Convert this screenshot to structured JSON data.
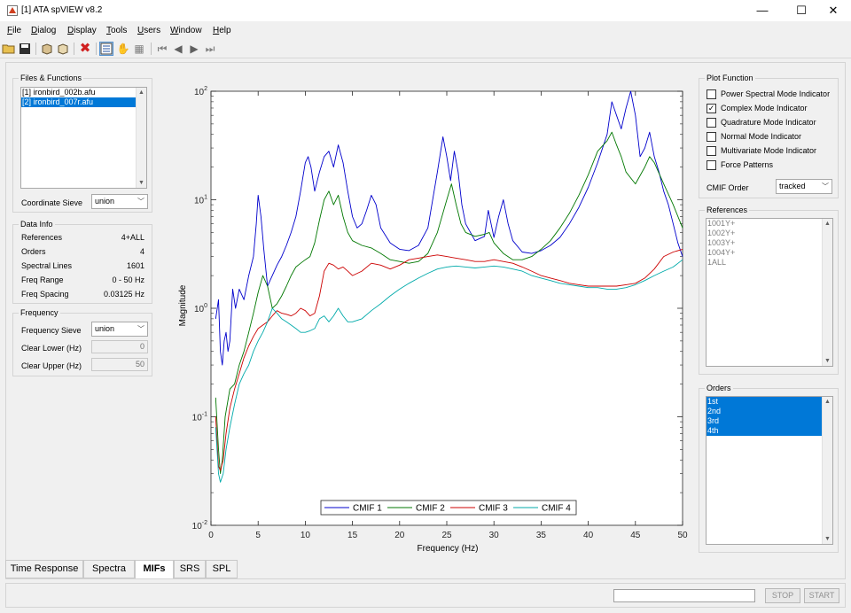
{
  "window": {
    "title": "[1] ATA spVIEW v8.2"
  },
  "menu": [
    {
      "label": "File",
      "u": "F",
      "rest": "ile"
    },
    {
      "label": "Dialog",
      "u": "D",
      "rest": "ialog"
    },
    {
      "label": "Display",
      "u": "D",
      "rest": "isplay"
    },
    {
      "label": "Tools",
      "u": "T",
      "rest": "ools"
    },
    {
      "label": "Users",
      "u": "U",
      "rest": "sers"
    },
    {
      "label": "Window",
      "u": "W",
      "rest": "indow"
    },
    {
      "label": "Help",
      "u": "H",
      "rest": "elp"
    }
  ],
  "files": {
    "title": "Files & Functions",
    "items": [
      "[1] ironbird_002b.afu",
      "[2] ironbird_007r.afu"
    ],
    "selected": 1,
    "coordinate_sieve_label": "Coordinate Sieve",
    "coordinate_sieve_value": "union"
  },
  "data_info": {
    "title": "Data Info",
    "rows": [
      {
        "label": "References",
        "value": "4+ALL"
      },
      {
        "label": "Orders",
        "value": "4"
      },
      {
        "label": "Spectral Lines",
        "value": "1601"
      },
      {
        "label": "Freq Range",
        "value": "0 - 50 Hz"
      },
      {
        "label": "Freq Spacing",
        "value": "0.03125 Hz"
      }
    ]
  },
  "frequency": {
    "title": "Frequency",
    "sieve_label": "Frequency Sieve",
    "sieve_value": "union",
    "clear_lower_label": "Clear Lower (Hz)",
    "clear_lower_value": "0",
    "clear_upper_label": "Clear Upper (Hz)",
    "clear_upper_value": "50"
  },
  "plot_function": {
    "title": "Plot Function",
    "options": [
      {
        "label": "Power Spectral Mode Indicator",
        "checked": false
      },
      {
        "label": "Complex Mode Indicator",
        "checked": true
      },
      {
        "label": "Quadrature Mode Indicator",
        "checked": false
      },
      {
        "label": "Normal Mode Indicator",
        "checked": false
      },
      {
        "label": "Multivariate Mode Indicator",
        "checked": false
      },
      {
        "label": "Force Patterns",
        "checked": false
      }
    ],
    "cmif_order_label": "CMIF Order",
    "cmif_order_value": "tracked"
  },
  "references": {
    "title": "References",
    "items": [
      "1001Y+",
      "1002Y+",
      "1003Y+",
      "1004Y+",
      "1ALL"
    ]
  },
  "orders": {
    "title": "Orders",
    "items": [
      "1st",
      "2nd",
      "3rd",
      "4th"
    ]
  },
  "tabs": [
    {
      "label": "Time Response",
      "active": false
    },
    {
      "label": "Spectra",
      "active": false
    },
    {
      "label": "MIFs",
      "active": true
    },
    {
      "label": "SRS",
      "active": false
    },
    {
      "label": "SPL",
      "active": false
    }
  ],
  "status": {
    "stop_label": "STOP",
    "start_label": "START"
  },
  "chart_data": {
    "type": "line",
    "xlabel": "Frequency (Hz)",
    "ylabel": "Magnitude",
    "xlim": [
      0,
      50
    ],
    "ylim": [
      0.01,
      100
    ],
    "yscale": "log",
    "xticks": [
      "0",
      "5",
      "10",
      "15",
      "20",
      "25",
      "30",
      "35",
      "40",
      "45",
      "50"
    ],
    "yticks": [
      {
        "base": "10",
        "exp": "-2"
      },
      {
        "base": "10",
        "exp": "-1"
      },
      {
        "base": "10",
        "exp": "0"
      },
      {
        "base": "10",
        "exp": "1"
      },
      {
        "base": "10",
        "exp": "2"
      }
    ],
    "legend_position": "bottom-center",
    "series": [
      {
        "name": "CMIF 1",
        "color": "#0000cc",
        "x": [
          0.5,
          0.8,
          1.0,
          1.2,
          1.4,
          1.6,
          1.8,
          2.0,
          2.3,
          2.6,
          3.0,
          3.5,
          4.0,
          4.5,
          4.8,
          5.0,
          5.3,
          5.6,
          6.0,
          6.5,
          7.0,
          7.5,
          8.0,
          8.5,
          9.0,
          9.5,
          10.0,
          10.3,
          10.6,
          11.0,
          11.5,
          12.0,
          12.5,
          13.0,
          13.5,
          14.0,
          14.5,
          15.0,
          15.5,
          16.0,
          16.5,
          17.0,
          17.5,
          18.0,
          19.0,
          20.0,
          21.0,
          22.0,
          23.0,
          24.0,
          24.6,
          25.0,
          25.4,
          25.8,
          26.2,
          26.6,
          27.0,
          28.0,
          29.0,
          29.4,
          30.0,
          30.5,
          31.0,
          31.5,
          32.0,
          33.0,
          34.0,
          35.0,
          36.0,
          37.0,
          38.0,
          39.0,
          40.0,
          41.0,
          42.0,
          42.5,
          43.0,
          43.5,
          44.0,
          44.5,
          45.0,
          45.5,
          46.0,
          46.5,
          47.0,
          47.5,
          48.0,
          48.5,
          49.0,
          49.5,
          50.0
        ],
        "y": [
          0.8,
          1.2,
          0.4,
          0.3,
          0.5,
          0.6,
          0.4,
          0.5,
          1.5,
          1.0,
          1.5,
          1.2,
          2.0,
          3.0,
          6.0,
          11.0,
          7.0,
          3.5,
          1.6,
          2.0,
          2.5,
          3.0,
          3.8,
          5.0,
          7.0,
          12.0,
          22.0,
          25.0,
          20.0,
          12.0,
          18.0,
          25.0,
          28.0,
          20.0,
          32.0,
          22.0,
          12.0,
          7.0,
          5.5,
          6.0,
          8.0,
          11.0,
          9.0,
          5.5,
          4.0,
          3.5,
          3.4,
          3.8,
          5.5,
          18.0,
          38.0,
          25.0,
          15.0,
          28.0,
          18.0,
          9.0,
          6.0,
          4.2,
          4.6,
          8.0,
          4.5,
          7.0,
          10.0,
          6.0,
          4.2,
          3.3,
          3.2,
          3.4,
          3.8,
          4.5,
          6.0,
          8.5,
          13.0,
          22.0,
          40.0,
          80.0,
          60.0,
          45.0,
          70.0,
          100.0,
          60.0,
          25.0,
          30.0,
          42.0,
          25.0,
          18.0,
          12.0,
          9.0,
          6.0,
          4.0,
          3.0
        ]
      },
      {
        "name": "CMIF 2",
        "color": "#007700",
        "x": [
          0.5,
          0.8,
          1.0,
          1.2,
          1.5,
          2.0,
          2.5,
          3.0,
          3.5,
          4.0,
          4.5,
          5.0,
          5.5,
          6.0,
          6.5,
          7.0,
          7.5,
          8.0,
          8.5,
          9.0,
          9.5,
          10.0,
          10.5,
          11.0,
          11.5,
          12.0,
          12.5,
          13.0,
          13.5,
          14.0,
          14.5,
          15.0,
          16.0,
          17.0,
          18.0,
          19.0,
          20.0,
          21.0,
          22.0,
          23.0,
          24.0,
          25.0,
          25.5,
          26.0,
          26.5,
          27.0,
          28.0,
          29.0,
          29.5,
          30.0,
          31.0,
          32.0,
          33.0,
          34.0,
          35.0,
          36.0,
          37.0,
          38.0,
          39.0,
          40.0,
          41.0,
          42.0,
          42.5,
          43.0,
          43.5,
          44.0,
          45.0,
          46.0,
          46.5,
          47.0,
          48.0,
          49.0,
          50.0
        ],
        "y": [
          0.15,
          0.05,
          0.03,
          0.04,
          0.1,
          0.18,
          0.2,
          0.3,
          0.4,
          0.6,
          0.9,
          1.4,
          2.0,
          1.6,
          1.0,
          1.1,
          1.3,
          1.6,
          2.0,
          2.4,
          2.6,
          2.8,
          3.0,
          4.0,
          6.5,
          10.0,
          12.0,
          9.0,
          11.0,
          7.0,
          5.0,
          4.2,
          3.8,
          3.6,
          3.2,
          2.8,
          2.7,
          2.6,
          2.7,
          3.2,
          5.0,
          10.0,
          14.0,
          9.0,
          6.0,
          5.0,
          4.6,
          4.8,
          5.0,
          4.0,
          3.2,
          2.8,
          2.8,
          3.0,
          3.5,
          4.2,
          5.5,
          7.5,
          11.0,
          17.0,
          28.0,
          35.0,
          42.0,
          32.0,
          25.0,
          18.0,
          14.0,
          20.0,
          25.0,
          22.0,
          14.0,
          9.0,
          5.5
        ]
      },
      {
        "name": "CMIF 3",
        "color": "#cc0000",
        "x": [
          0.5,
          0.8,
          1.0,
          1.3,
          1.6,
          2.0,
          2.5,
          3.0,
          3.5,
          4.0,
          4.5,
          5.0,
          5.5,
          6.0,
          6.5,
          7.0,
          7.5,
          8.0,
          8.5,
          9.0,
          9.5,
          10.0,
          10.5,
          11.0,
          11.5,
          12.0,
          12.5,
          13.0,
          13.5,
          14.0,
          14.5,
          15.0,
          16.0,
          17.0,
          18.0,
          19.0,
          20.0,
          21.0,
          22.0,
          23.0,
          24.0,
          25.0,
          26.0,
          27.0,
          28.0,
          29.0,
          30.0,
          31.0,
          32.0,
          33.0,
          34.0,
          35.0,
          36.0,
          37.0,
          38.0,
          39.0,
          40.0,
          41.0,
          42.0,
          43.0,
          44.0,
          45.0,
          46.0,
          47.0,
          48.0,
          49.0,
          50.0
        ],
        "y": [
          0.1,
          0.035,
          0.032,
          0.04,
          0.07,
          0.12,
          0.18,
          0.25,
          0.35,
          0.45,
          0.55,
          0.65,
          0.7,
          0.75,
          0.85,
          0.95,
          0.9,
          0.88,
          0.85,
          0.9,
          1.0,
          0.95,
          0.85,
          0.9,
          1.3,
          2.2,
          2.6,
          2.5,
          2.3,
          2.4,
          2.2,
          2.0,
          2.2,
          2.6,
          2.5,
          2.3,
          2.5,
          2.8,
          2.9,
          3.0,
          3.1,
          3.0,
          2.9,
          2.8,
          2.7,
          2.7,
          2.8,
          2.7,
          2.6,
          2.4,
          2.2,
          2.0,
          1.9,
          1.8,
          1.7,
          1.65,
          1.6,
          1.6,
          1.6,
          1.6,
          1.65,
          1.7,
          1.9,
          2.3,
          3.0,
          3.3,
          3.5
        ]
      },
      {
        "name": "CMIF 4",
        "color": "#00aaaa",
        "x": [
          0.5,
          0.8,
          1.0,
          1.3,
          1.6,
          2.0,
          2.5,
          3.0,
          3.5,
          4.0,
          4.5,
          5.0,
          5.5,
          6.0,
          6.5,
          7.0,
          7.5,
          8.0,
          8.5,
          9.0,
          9.5,
          10.0,
          10.5,
          11.0,
          11.5,
          12.0,
          12.5,
          13.0,
          13.5,
          14.0,
          14.5,
          15.0,
          16.0,
          17.0,
          18.0,
          19.0,
          20.0,
          21.0,
          22.0,
          23.0,
          24.0,
          25.0,
          26.0,
          27.0,
          28.0,
          29.0,
          30.0,
          31.0,
          32.0,
          33.0,
          34.0,
          35.0,
          36.0,
          37.0,
          38.0,
          39.0,
          40.0,
          41.0,
          42.0,
          43.0,
          44.0,
          45.0,
          46.0,
          47.0,
          48.0,
          49.0,
          50.0
        ],
        "y": [
          0.08,
          0.03,
          0.025,
          0.03,
          0.05,
          0.08,
          0.13,
          0.2,
          0.25,
          0.3,
          0.4,
          0.5,
          0.6,
          0.75,
          1.0,
          0.9,
          0.8,
          0.75,
          0.7,
          0.65,
          0.6,
          0.6,
          0.62,
          0.65,
          0.8,
          0.85,
          0.75,
          0.85,
          1.0,
          0.85,
          0.75,
          0.75,
          0.8,
          0.95,
          1.1,
          1.3,
          1.5,
          1.7,
          1.9,
          2.1,
          2.3,
          2.4,
          2.45,
          2.4,
          2.35,
          2.4,
          2.45,
          2.4,
          2.3,
          2.2,
          2.0,
          1.9,
          1.8,
          1.7,
          1.65,
          1.6,
          1.55,
          1.55,
          1.5,
          1.5,
          1.55,
          1.65,
          1.8,
          2.0,
          2.2,
          2.4,
          2.8
        ]
      }
    ]
  }
}
